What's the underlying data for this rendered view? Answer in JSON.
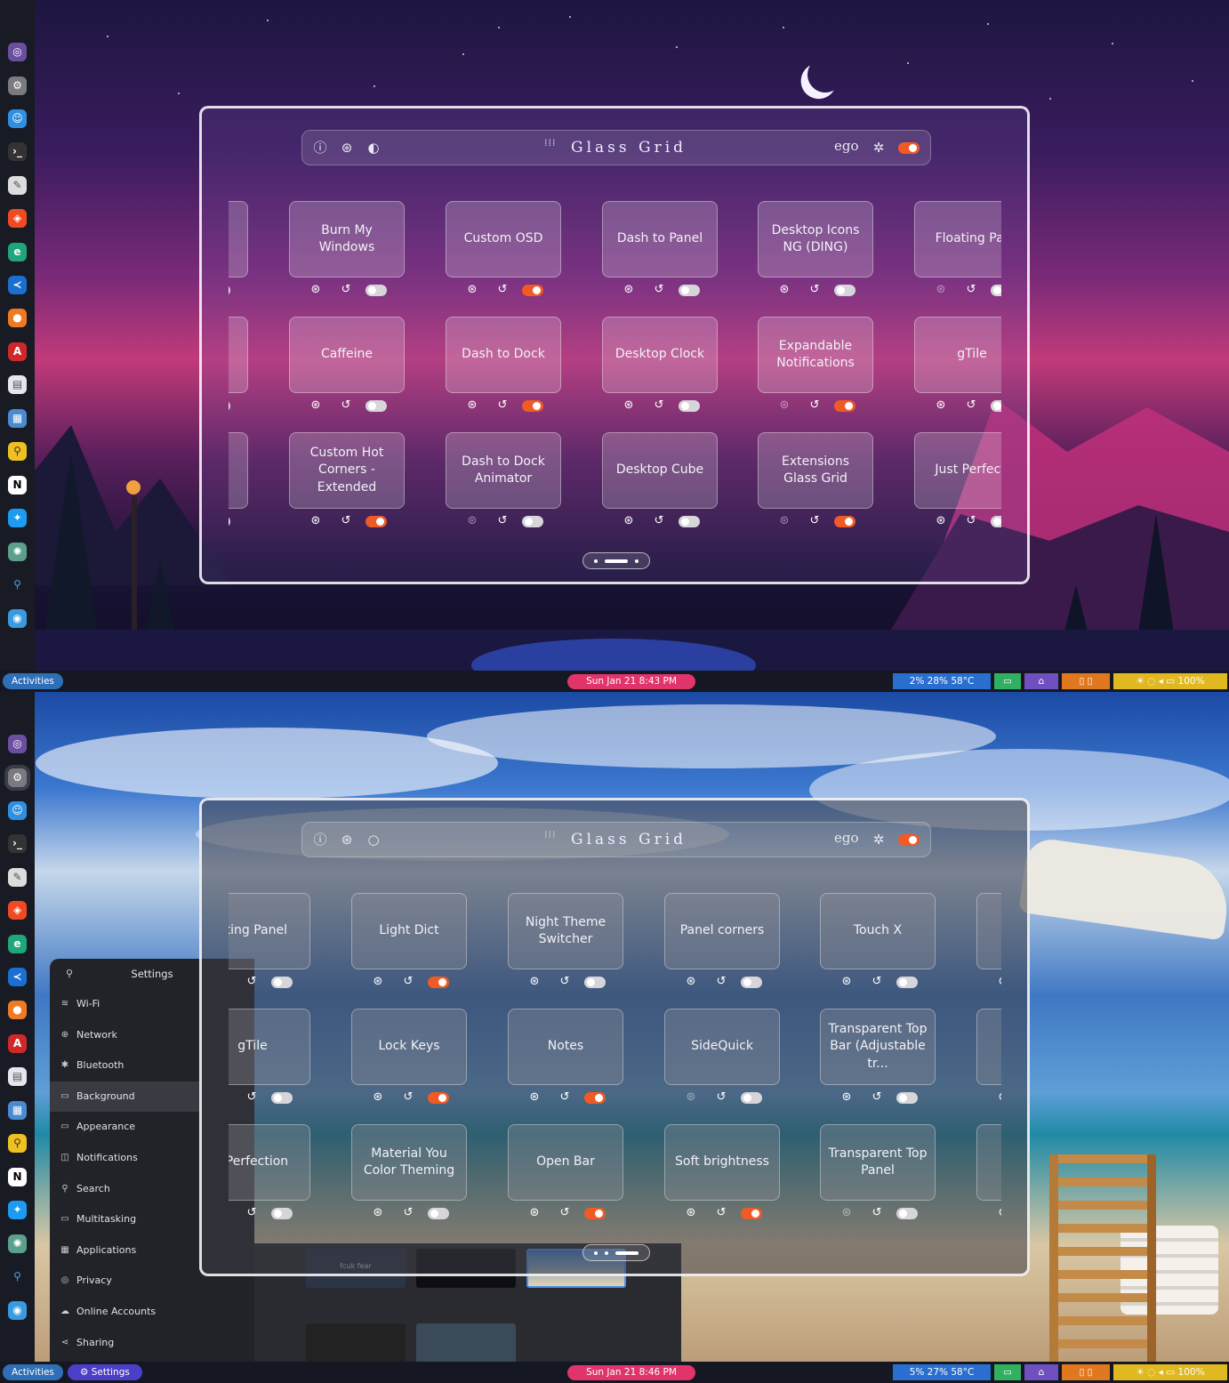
{
  "top": {
    "glass": {
      "title": "Glass Grid",
      "ego": "ego",
      "rows": [
        [
          {
            "label": "",
            "enabled": false,
            "dim": false
          },
          {
            "label": "Burn My Windows",
            "enabled": false,
            "dim": false
          },
          {
            "label": "Custom OSD",
            "enabled": true,
            "dim": false
          },
          {
            "label": "Dash to Panel",
            "enabled": false,
            "dim": false
          },
          {
            "label": "Desktop Icons NG (DING)",
            "enabled": false,
            "dim": false
          },
          {
            "label": "Floating Par",
            "enabled": false,
            "dim": true
          }
        ],
        [
          {
            "label": "",
            "enabled": false,
            "dim": false
          },
          {
            "label": "Caffeine",
            "enabled": false,
            "dim": false
          },
          {
            "label": "Dash to Dock",
            "enabled": true,
            "dim": false
          },
          {
            "label": "Desktop Clock",
            "enabled": false,
            "dim": false
          },
          {
            "label": "Expandable Notifications",
            "enabled": true,
            "dim": true
          },
          {
            "label": "gTile",
            "enabled": false,
            "dim": false
          }
        ],
        [
          {
            "label": "",
            "enabled": false,
            "dim": false
          },
          {
            "label": "Custom Hot Corners - Extended",
            "enabled": true,
            "dim": false
          },
          {
            "label": "Dash to Dock Animator",
            "enabled": false,
            "dim": true
          },
          {
            "label": "Desktop Cube",
            "enabled": false,
            "dim": false
          },
          {
            "label": "Extensions Glass Grid",
            "enabled": true,
            "dim": true
          },
          {
            "label": "Just Perfecti",
            "enabled": false,
            "dim": false
          }
        ]
      ]
    },
    "taskbar": {
      "activities": "Activities",
      "clock": "Sun Jan 21   8:43 PM",
      "stats": "2%   28%   58°C",
      "battery": "100%"
    }
  },
  "bottom": {
    "glass": {
      "title": "Glass Grid",
      "ego": "ego",
      "rows": [
        [
          {
            "label": "ating Panel",
            "enabled": false,
            "dim": false
          },
          {
            "label": "Light Dict",
            "enabled": true,
            "dim": false
          },
          {
            "label": "Night Theme Switcher",
            "enabled": false,
            "dim": false
          },
          {
            "label": "Panel corners",
            "enabled": false,
            "dim": false
          },
          {
            "label": "Touch X",
            "enabled": false,
            "dim": false
          },
          {
            "label": "A",
            "enabled": false,
            "dim": false
          }
        ],
        [
          {
            "label": "gTile",
            "enabled": false,
            "dim": false
          },
          {
            "label": "Lock Keys",
            "enabled": true,
            "dim": false
          },
          {
            "label": "Notes",
            "enabled": true,
            "dim": false
          },
          {
            "label": "SideQuick",
            "enabled": false,
            "dim": true
          },
          {
            "label": "Transparent Top Bar (Adjustable tr...",
            "enabled": false,
            "dim": false
          },
          {
            "label": "U",
            "enabled": false,
            "dim": false
          }
        ],
        [
          {
            "label": "t Perfection",
            "enabled": false,
            "dim": false
          },
          {
            "label": "Material You Color Theming",
            "enabled": false,
            "dim": false
          },
          {
            "label": "Open Bar",
            "enabled": true,
            "dim": false
          },
          {
            "label": "Soft brightness",
            "enabled": true,
            "dim": false
          },
          {
            "label": "Transparent Top Panel",
            "enabled": false,
            "dim": true
          },
          {
            "label": "U",
            "enabled": false,
            "dim": false
          }
        ]
      ]
    },
    "settings": {
      "title": "Settings",
      "items": [
        "Wi-Fi",
        "Network",
        "Bluetooth",
        "Background",
        "Appearance",
        "Notifications",
        "Search",
        "Multitasking",
        "Applications",
        "Privacy",
        "Online Accounts",
        "Sharing"
      ],
      "selected": "Background",
      "thumb_text": "fcuk fear"
    },
    "taskbar": {
      "activities": "Activities",
      "app": "Settings",
      "clock": "Sun Jan 21   8:46 PM",
      "stats": "5%   27%   58°C",
      "battery": "100%"
    }
  },
  "colors": {
    "toggle_on": "#f05a24",
    "toggle_off": "#d5d5da",
    "activities": "#2f6fb8",
    "clock": "#e0346a"
  },
  "dock_icons": [
    "screen-recorder-icon",
    "settings-gear-icon",
    "finder-icon",
    "terminal-icon",
    "notes-icon",
    "brave-browser-icon",
    "edge-browser-icon",
    "vscode-icon",
    "firefox-icon",
    "pdf-reader-icon",
    "text-editor-icon",
    "file-manager-icon",
    "search-app-icon",
    "notion-icon",
    "twitter-icon",
    "chatgpt-icon",
    "magnifier-icon",
    "app-store-icon"
  ]
}
